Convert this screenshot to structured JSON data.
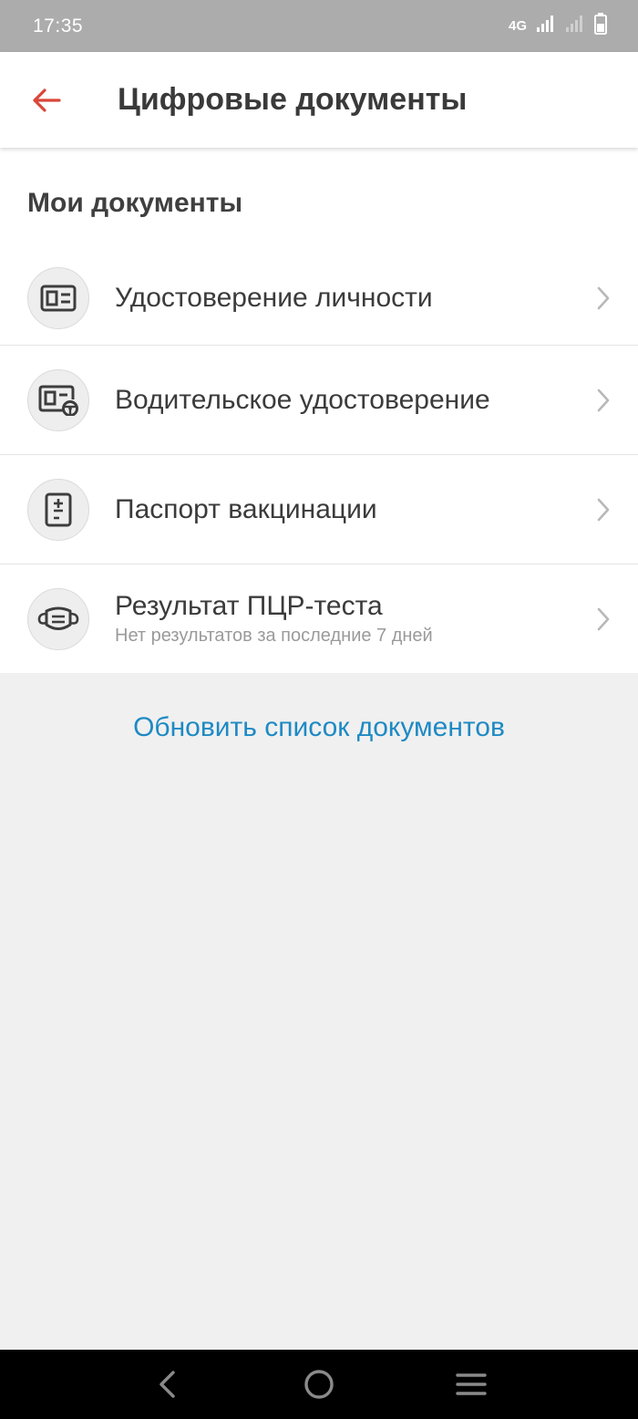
{
  "status_bar": {
    "time": "17:35",
    "network": "4G",
    "icons": [
      "signal-icon",
      "signal-empty-icon",
      "battery-icon"
    ]
  },
  "app_bar": {
    "title": "Цифровые документы",
    "back_icon": "arrow-left-icon",
    "accent_color": "#d9473a"
  },
  "section": {
    "title": "Мои документы"
  },
  "documents": [
    {
      "label": "Удостоверение личности",
      "icon": "id-card-icon"
    },
    {
      "label": "Водительское удостоверение",
      "icon": "driver-license-icon"
    },
    {
      "label": "Паспорт вакцинации",
      "icon": "vaccination-document-icon"
    },
    {
      "label": "Результат ПЦР-теста",
      "sublabel": "Нет результатов за последние 7 дней",
      "icon": "mask-icon"
    }
  ],
  "refresh": {
    "label": "Обновить список документов",
    "color": "#1e8ac4"
  },
  "nav_bar": {
    "icons": [
      "nav-back-icon",
      "nav-home-icon",
      "nav-menu-icon"
    ]
  }
}
